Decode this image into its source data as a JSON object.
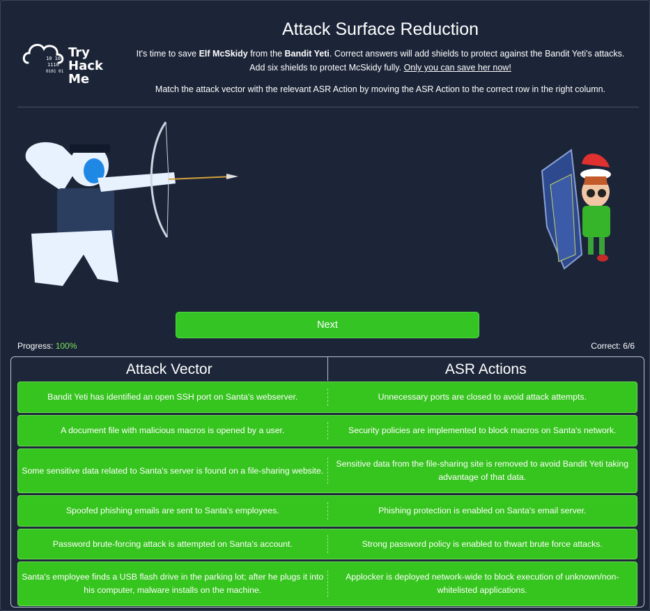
{
  "logo": {
    "line1": "Try",
    "line2": "Hack",
    "line3": "Me",
    "bits1": "10  10",
    "bits2": "1110",
    "bits3": "0101  01"
  },
  "header": {
    "title": "Attack Surface Reduction",
    "intro_part1": "It's time to save ",
    "intro_bold1": "Elf McSkidy",
    "intro_part2": " from the ",
    "intro_bold2": "Bandit Yeti",
    "intro_part3": ". Correct answers will add shields to protect against the Bandit Yeti's attacks. Add six shields to protect McSkidy fully. ",
    "intro_link": "Only you can save her now!",
    "instruction": "Match the attack vector with the relevant ASR Action by moving the ASR Action to the correct row in the right column."
  },
  "next_label": "Next",
  "progress": {
    "label": "Progress: ",
    "value": "100%"
  },
  "correct": "Correct: 6/6",
  "table": {
    "col_left": "Attack Vector",
    "col_right": "ASR Actions",
    "rows": [
      {
        "vector": "Bandit Yeti has identified an open SSH port on Santa's webserver.",
        "action": "Unnecessary ports are closed to avoid attack attempts."
      },
      {
        "vector": "A document file with malicious macros is opened by a user.",
        "action": "Security policies are implemented to block macros on Santa's network."
      },
      {
        "vector": "Some sensitive data related to Santa's server is found on a file-sharing website.",
        "action": "Sensitive data from the file-sharing site is removed to avoid Bandit Yeti taking advantage of that data."
      },
      {
        "vector": "Spoofed phishing emails are sent to Santa's employees.",
        "action": "Phishing protection is enabled on Santa's email server."
      },
      {
        "vector": "Password brute-forcing attack is attempted on Santa's account.",
        "action": "Strong password policy is enabled to thwart brute force attacks."
      },
      {
        "vector": "Santa's employee finds a USB flash drive in the parking lot; after he plugs it into his computer, malware installs on the machine.",
        "action": "Applocker is deployed network-wide to block execution of unknown/non-whitelisted applications."
      }
    ]
  },
  "colors": {
    "background": "#1c2538",
    "accent_green": "#36c41e",
    "progress_green": "#7de35a"
  }
}
